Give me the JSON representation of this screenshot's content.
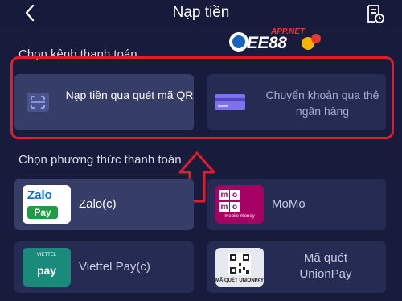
{
  "header": {
    "title": "Nạp tiền",
    "back_icon": "chevron-left-icon",
    "history_icon": "receipt-history-icon"
  },
  "watermark": {
    "brand": "EE88",
    "badge": "APP.NET"
  },
  "channel_section": {
    "label": "Chọn kênh thanh toán",
    "items": [
      {
        "label": "Nạp tiền qua quét mã QR",
        "icon": "qr-scan-icon",
        "selected": true
      },
      {
        "label": "Chuyển khoản qua thẻ ngân hàng",
        "icon": "bank-card-icon",
        "selected": false
      }
    ]
  },
  "method_section": {
    "label": "Chọn phương thức thanh toán",
    "items": [
      {
        "label": "Zalo(c)",
        "logo_top": "Zalo",
        "logo_bottom": "Pay",
        "selected": true
      },
      {
        "label": "MoMo",
        "logo_letters": [
          "m",
          "o",
          "m",
          "o"
        ],
        "logo_sub": "mobile money",
        "selected": false
      },
      {
        "label": "Viettel Pay(c)",
        "logo_top": "VIETTEL",
        "logo_bottom": "pay",
        "selected": false
      },
      {
        "label": "Mã quét UnionPay",
        "logo_sub": "MÃ QUÉT UNIONPAY",
        "selected": false
      }
    ]
  },
  "colors": {
    "background": "#171c3d",
    "card_selected": "#363d67",
    "card": "#252b52",
    "highlight": "#e31b2c"
  }
}
